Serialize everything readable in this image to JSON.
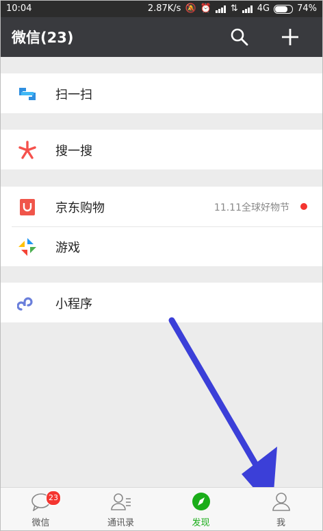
{
  "status": {
    "time": "10:04",
    "speed": "2.87K/s",
    "network": "4G",
    "battery": "74%"
  },
  "header": {
    "title": "微信(23)"
  },
  "sections": [
    {
      "items": [
        {
          "label": "扫一扫"
        }
      ]
    },
    {
      "items": [
        {
          "label": "搜一搜"
        }
      ]
    },
    {
      "items": [
        {
          "label": "京东购物",
          "extra": "11.11全球好物节"
        },
        {
          "label": "游戏"
        }
      ]
    },
    {
      "items": [
        {
          "label": "小程序"
        }
      ]
    }
  ],
  "tabs": [
    {
      "label": "微信",
      "badge": "23"
    },
    {
      "label": "通讯录"
    },
    {
      "label": "发现"
    },
    {
      "label": "我"
    }
  ],
  "colors": {
    "accent": "#1aad19",
    "header": "#393a3e",
    "badge": "#f43530",
    "arrow": "#3b3fd8"
  }
}
